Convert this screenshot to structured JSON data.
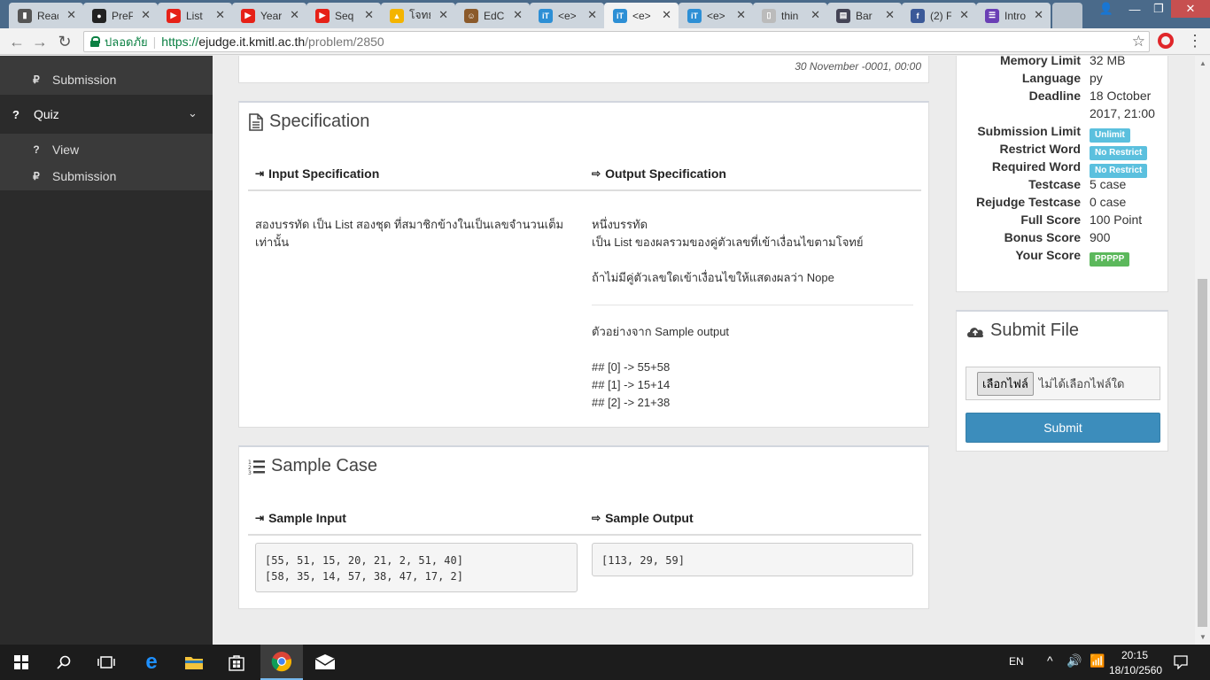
{
  "browser": {
    "tabs": [
      {
        "label": "Read",
        "favicon": "book-icon"
      },
      {
        "label": "PreP",
        "favicon": "github-icon"
      },
      {
        "label": "List",
        "favicon": "youtube-icon"
      },
      {
        "label": "Year",
        "favicon": "youtube-icon"
      },
      {
        "label": "Seq",
        "favicon": "youtube-icon"
      },
      {
        "label": "โจทย",
        "favicon": "google-drive-icon"
      },
      {
        "label": "EdCl",
        "favicon": "face-icon"
      },
      {
        "label": "<e>",
        "favicon": "ejudge-icon"
      },
      {
        "label": "<e>",
        "favicon": "ejudge-icon"
      },
      {
        "label": "<e>",
        "favicon": "ejudge-icon"
      },
      {
        "label": "thin",
        "favicon": "page-icon"
      },
      {
        "label": "Bar",
        "favicon": "layout-icon"
      },
      {
        "label": "(2) F",
        "favicon": "facebook-icon"
      },
      {
        "label": "Intro",
        "favicon": "list-icon"
      }
    ],
    "active_tab_index": 8,
    "tab_close": "✕",
    "omnibox": {
      "secure_label": "ปลอดภัย",
      "url_scheme": "https://",
      "url_host": "ejudge.it.kmitl.ac.th",
      "url_path": "/problem/2850"
    }
  },
  "sidebar": {
    "top_item": {
      "icon": "₽",
      "label": "Submission"
    },
    "quiz": {
      "icon": "?",
      "label": "Quiz",
      "chevron": "⌄"
    },
    "quiz_items": [
      {
        "icon": "?",
        "label": "View"
      },
      {
        "icon": "₽",
        "label": "Submission"
      }
    ]
  },
  "top_panel": {
    "timestamp": "30 November -0001, 00:00"
  },
  "specification": {
    "title": "Specification",
    "input_header": "Input Specification",
    "output_header": "Output Specification",
    "input_text": "สองบรรทัด เป็น List สองชุด ที่สมาชิกข้างในเป็นเลขจำนวนเต็มเท่านั้น",
    "output_line1": "หนึ่งบรรทัด",
    "output_line2": "เป็น List ของผลรวมของคู่ตัวเลขที่เข้าเงื่อนไขตามโจทย์",
    "output_line3": "ถ้าไม่มีคู่ตัวเลขใดเข้าเงื่อนไขให้แสดงผลว่า Nope",
    "example_title": "ตัวอย่างจาก Sample output",
    "example_lines": [
      "## [0] -> 55+58",
      "## [1] -> 15+14",
      "## [2] -> 21+38"
    ]
  },
  "sample_case": {
    "title": "Sample Case",
    "input_header": "Sample Input",
    "output_header": "Sample Output",
    "input_lines": [
      "[55, 51, 15, 20, 21, 2, 51, 40]",
      "[58, 35, 14, 57, 38, 47, 17, 2]"
    ],
    "output": "[113, 29, 59]"
  },
  "problem_info": {
    "memory_limit": {
      "key": "Memory Limit",
      "value": "32 MB"
    },
    "language": {
      "key": "Language",
      "value": "py"
    },
    "deadline": {
      "key": "Deadline",
      "value_line1": "18 October",
      "value_line2": "2017, 21:00"
    },
    "submission_limit": {
      "key": "Submission Limit",
      "badge": "Unlimit"
    },
    "restrict_word": {
      "key": "Restrict Word",
      "badge": "No Restrict"
    },
    "required_word": {
      "key": "Required Word",
      "badge": "No Restrict"
    },
    "testcase": {
      "key": "Testcase",
      "value": "5 case"
    },
    "rejudge_testcase": {
      "key": "Rejudge Testcase",
      "value": "0 case"
    },
    "full_score": {
      "key": "Full Score",
      "value": "100 Point"
    },
    "bonus_score": {
      "key": "Bonus Score",
      "value": "900"
    },
    "your_score": {
      "key": "Your Score",
      "badge": "PPPPP"
    }
  },
  "submit_file": {
    "title": "Submit File",
    "choose_button": "เลือกไฟล์",
    "no_file_text": "ไม่ได้เลือกไฟล์ใด",
    "submit_button": "Submit"
  },
  "taskbar": {
    "language": "EN",
    "time": "20:15",
    "date": "18/10/2560"
  },
  "colors": {
    "primary": "#3c8dbc",
    "badge_info": "#5bc0de",
    "badge_success": "#5cb85c",
    "sidebar": "#2b2b2b"
  }
}
